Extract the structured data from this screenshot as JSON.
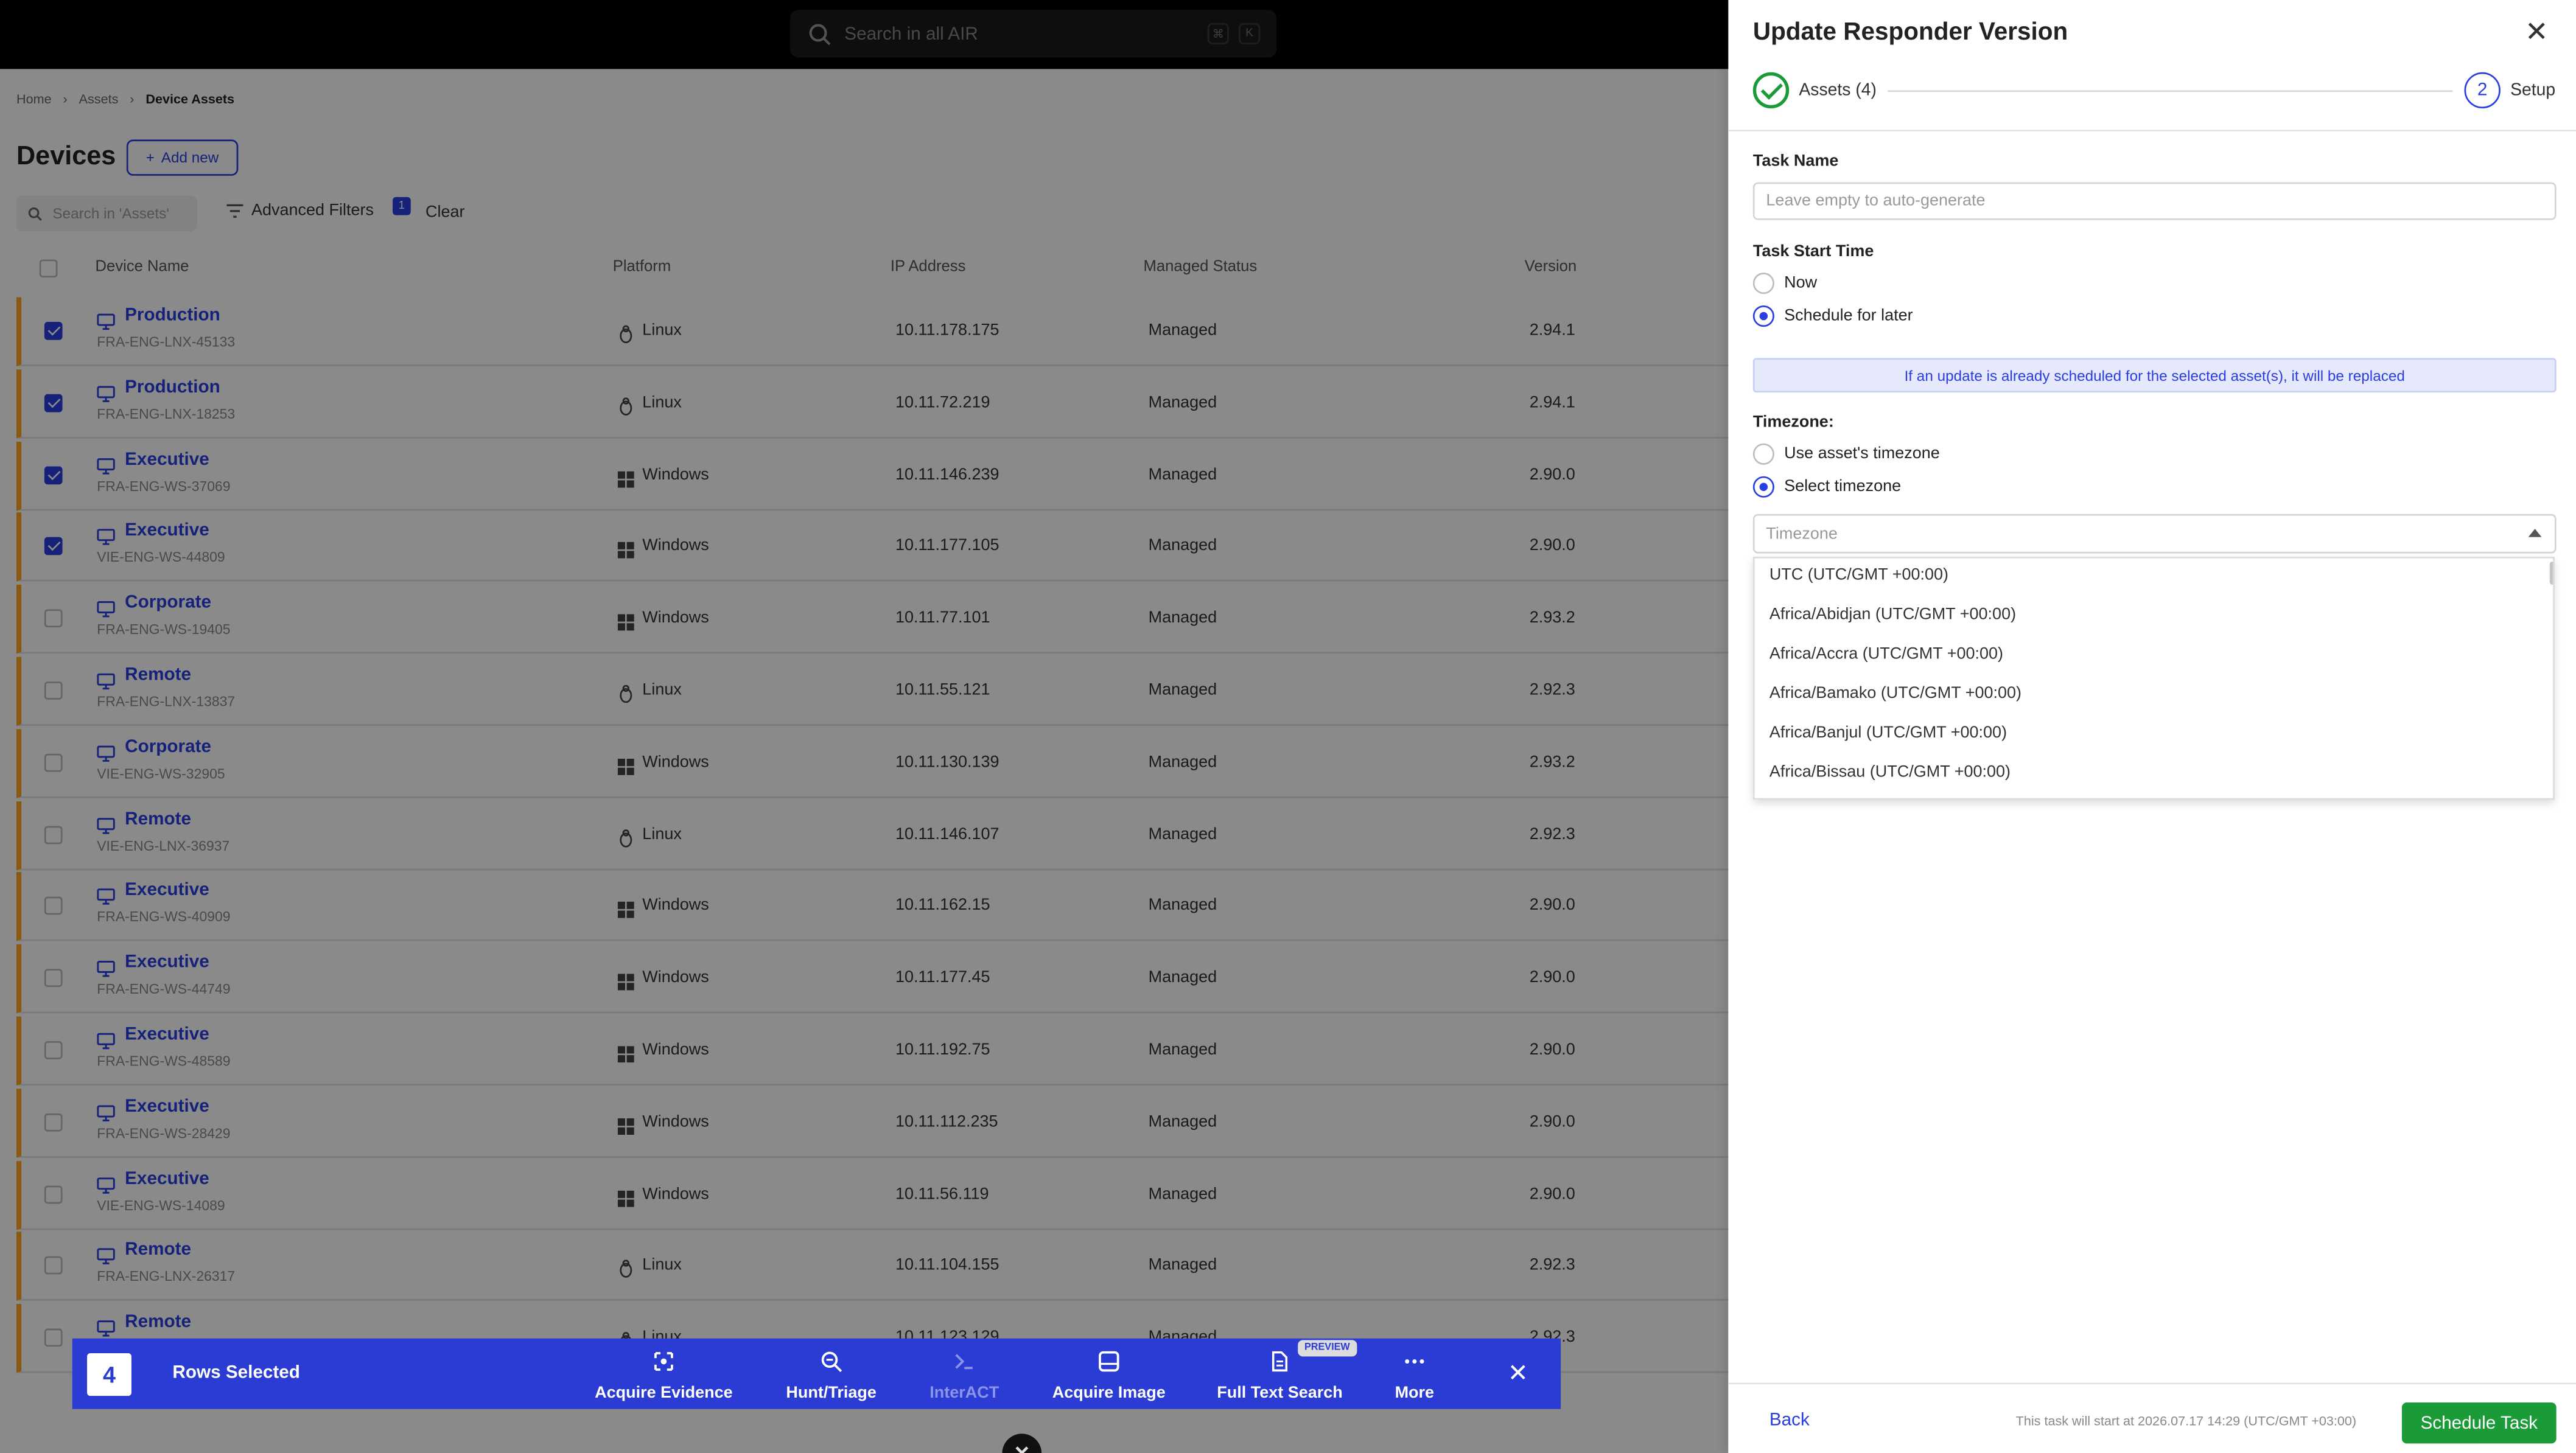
{
  "topbar": {
    "search_placeholder": "Search in all AIR",
    "shortcut_keys": [
      "⌘",
      "K"
    ]
  },
  "breadcrumb": [
    "Home",
    "Assets",
    "Device Assets"
  ],
  "page": {
    "title": "Devices",
    "add_new_label": "Add new",
    "search_placeholder": "Search in 'Assets'",
    "advanced_filters_label": "Advanced Filters",
    "filter_count": "1",
    "clear_label": "Clear"
  },
  "table": {
    "columns": [
      "Device Name",
      "Platform",
      "IP Address",
      "Managed Status",
      "Version"
    ],
    "rows": [
      {
        "name": "Production",
        "host": "FRA-ENG-LNX-45133",
        "platform": "Linux",
        "ip": "10.11.178.175",
        "status": "Managed",
        "version": "2.94.1",
        "checked": true
      },
      {
        "name": "Production",
        "host": "FRA-ENG-LNX-18253",
        "platform": "Linux",
        "ip": "10.11.72.219",
        "status": "Managed",
        "version": "2.94.1",
        "checked": true
      },
      {
        "name": "Executive",
        "host": "FRA-ENG-WS-37069",
        "platform": "Windows",
        "ip": "10.11.146.239",
        "status": "Managed",
        "version": "2.90.0",
        "checked": true
      },
      {
        "name": "Executive",
        "host": "VIE-ENG-WS-44809",
        "platform": "Windows",
        "ip": "10.11.177.105",
        "status": "Managed",
        "version": "2.90.0",
        "checked": true
      },
      {
        "name": "Corporate",
        "host": "FRA-ENG-WS-19405",
        "platform": "Windows",
        "ip": "10.11.77.101",
        "status": "Managed",
        "version": "2.93.2",
        "checked": false
      },
      {
        "name": "Remote",
        "host": "FRA-ENG-LNX-13837",
        "platform": "Linux",
        "ip": "10.11.55.121",
        "status": "Managed",
        "version": "2.92.3",
        "checked": false
      },
      {
        "name": "Corporate",
        "host": "VIE-ENG-WS-32905",
        "platform": "Windows",
        "ip": "10.11.130.139",
        "status": "Managed",
        "version": "2.93.2",
        "checked": false
      },
      {
        "name": "Remote",
        "host": "VIE-ENG-LNX-36937",
        "platform": "Linux",
        "ip": "10.11.146.107",
        "status": "Managed",
        "version": "2.92.3",
        "checked": false
      },
      {
        "name": "Executive",
        "host": "FRA-ENG-WS-40909",
        "platform": "Windows",
        "ip": "10.11.162.15",
        "status": "Managed",
        "version": "2.90.0",
        "checked": false
      },
      {
        "name": "Executive",
        "host": "FRA-ENG-WS-44749",
        "platform": "Windows",
        "ip": "10.11.177.45",
        "status": "Managed",
        "version": "2.90.0",
        "checked": false
      },
      {
        "name": "Executive",
        "host": "FRA-ENG-WS-48589",
        "platform": "Windows",
        "ip": "10.11.192.75",
        "status": "Managed",
        "version": "2.90.0",
        "checked": false
      },
      {
        "name": "Executive",
        "host": "FRA-ENG-WS-28429",
        "platform": "Windows",
        "ip": "10.11.112.235",
        "status": "Managed",
        "version": "2.90.0",
        "checked": false
      },
      {
        "name": "Executive",
        "host": "VIE-ENG-WS-14089",
        "platform": "Windows",
        "ip": "10.11.56.119",
        "status": "Managed",
        "version": "2.90.0",
        "checked": false
      },
      {
        "name": "Remote",
        "host": "FRA-ENG-LNX-26317",
        "platform": "Linux",
        "ip": "10.11.104.155",
        "status": "Managed",
        "version": "2.92.3",
        "checked": false
      },
      {
        "name": "Remote",
        "host": "",
        "platform": "Linux",
        "ip": "10.11.123.129",
        "status": "Managed",
        "version": "2.92.3",
        "checked": false
      }
    ]
  },
  "bulk_bar": {
    "count": "4",
    "label": "Rows Selected",
    "actions": [
      {
        "label": "Acquire Evidence",
        "icon": "evidence-icon",
        "disabled": false
      },
      {
        "label": "Hunt/Triage",
        "icon": "hunt-icon",
        "disabled": false
      },
      {
        "label": "InterACT",
        "icon": "terminal-icon",
        "disabled": true
      },
      {
        "label": "Acquire Image",
        "icon": "image-icon",
        "disabled": false
      },
      {
        "label": "Full Text Search",
        "icon": "document-search-icon",
        "disabled": false
      },
      {
        "label": "More",
        "icon": "more-icon",
        "disabled": false
      }
    ],
    "preview_badge": "PREVIEW",
    "close_glyph": "✕"
  },
  "bottom_close_glyph": "✕",
  "drawer": {
    "title": "Update Responder Version",
    "close_glyph": "✕",
    "steps": [
      {
        "label": "Assets (4)",
        "state": "done"
      },
      {
        "num": "2",
        "label": "Setup",
        "state": "active"
      }
    ],
    "task_name_label": "Task Name",
    "task_name_placeholder": "Leave empty to auto-generate",
    "task_start_label": "Task Start Time",
    "start_options": [
      {
        "label": "Now",
        "selected": false
      },
      {
        "label": "Schedule for later",
        "selected": true
      }
    ],
    "info_banner": "If an update is already scheduled for the selected asset(s), it will be replaced",
    "timezone_label": "Timezone:",
    "tz_options": [
      {
        "label": "Use asset's timezone",
        "selected": false
      },
      {
        "label": "Select timezone",
        "selected": true
      }
    ],
    "tz_placeholder": "Timezone",
    "tz_list": [
      "UTC (UTC/GMT +00:00)",
      "Africa/Abidjan (UTC/GMT +00:00)",
      "Africa/Accra (UTC/GMT +00:00)",
      "Africa/Bamako (UTC/GMT +00:00)",
      "Africa/Banjul (UTC/GMT +00:00)",
      "Africa/Bissau (UTC/GMT +00:00)"
    ],
    "back_label": "Back",
    "footer_note": "This task will start at 2026.07.17 14:29 (UTC/GMT +03:00)",
    "schedule_label": "Schedule Task"
  },
  "colors": {
    "accent": "#2a3de0",
    "success": "#1a9b38",
    "row_marker": "#ffa41c",
    "bulk_bar": "#2b3cd4"
  }
}
